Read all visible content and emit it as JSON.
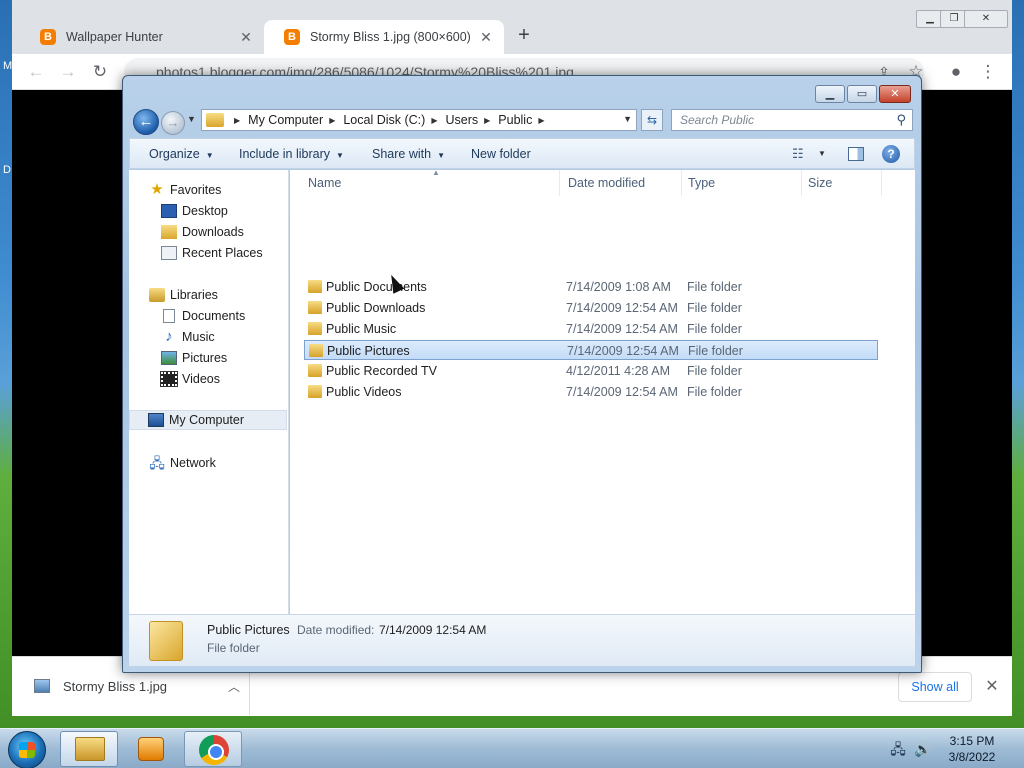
{
  "browser": {
    "tabs": [
      {
        "title": "Wallpaper Hunter",
        "favicon": "blogger-icon",
        "active": false
      },
      {
        "title": "Stormy Bliss 1.jpg (800×600)",
        "favicon": "blogger-icon",
        "active": true
      }
    ],
    "url": "photos1.blogger.com/img/286/5086/1024/Stormy%20Bliss%201.jpg",
    "side_letters": [
      "M",
      "D"
    ],
    "download": {
      "filename": "Stormy Bliss 1.jpg",
      "show_all_label": "Show all"
    }
  },
  "explorer": {
    "breadcrumbs": [
      "My Computer",
      "Local Disk (C:)",
      "Users",
      "Public"
    ],
    "search_placeholder": "Search Public",
    "commands": {
      "organize": "Organize",
      "include_in_library": "Include in library",
      "share_with": "Share with",
      "new_folder": "New folder"
    },
    "nav": {
      "favorites": "Favorites",
      "desktop": "Desktop",
      "downloads": "Downloads",
      "recent_places": "Recent Places",
      "libraries": "Libraries",
      "documents": "Documents",
      "music": "Music",
      "pictures": "Pictures",
      "videos": "Videos",
      "my_computer": "My Computer",
      "network": "Network"
    },
    "columns": {
      "name": "Name",
      "date_modified": "Date modified",
      "type": "Type",
      "size": "Size"
    },
    "rows": [
      {
        "name": "Public Documents",
        "date": "7/14/2009 1:08 AM",
        "type": "File folder"
      },
      {
        "name": "Public Downloads",
        "date": "7/14/2009 12:54 AM",
        "type": "File folder"
      },
      {
        "name": "Public Music",
        "date": "7/14/2009 12:54 AM",
        "type": "File folder"
      },
      {
        "name": "Public Pictures",
        "date": "7/14/2009 12:54 AM",
        "type": "File folder"
      },
      {
        "name": "Public Recorded TV",
        "date": "4/12/2011 4:28 AM",
        "type": "File folder"
      },
      {
        "name": "Public Videos",
        "date": "7/14/2009 12:54 AM",
        "type": "File folder"
      }
    ],
    "selected_row": 3,
    "details": {
      "name": "Public Pictures",
      "date_label": "Date modified:",
      "date": "7/14/2009 12:54 AM",
      "type": "File folder"
    }
  },
  "taskbar": {
    "time": "3:15 PM",
    "date": "3/8/2022"
  }
}
